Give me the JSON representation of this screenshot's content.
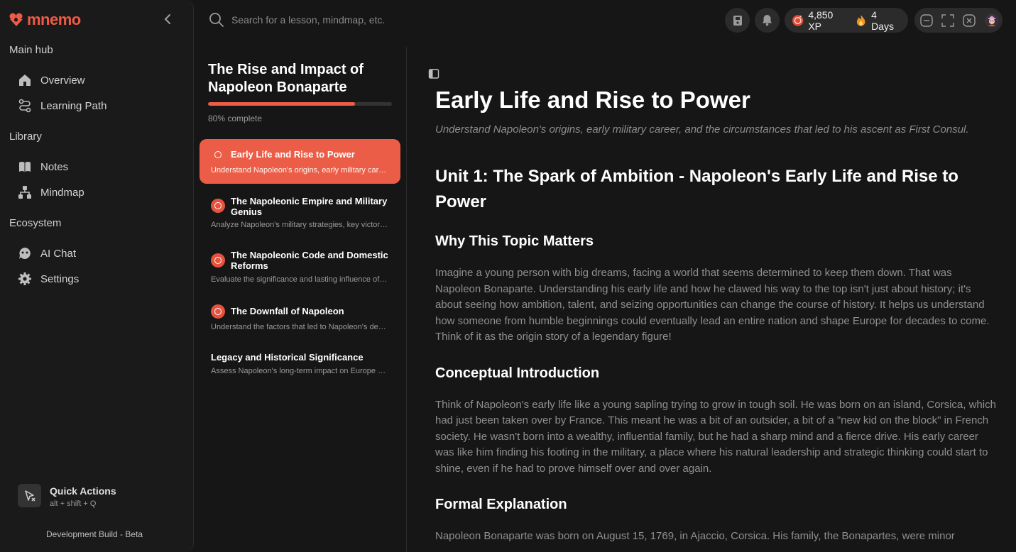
{
  "app": {
    "logo_text": "mnemo",
    "brand_color": "#ef5b45"
  },
  "sidebar": {
    "sections": [
      {
        "label": "Main hub",
        "items": [
          {
            "label": "Overview",
            "icon": "home-icon"
          },
          {
            "label": "Learning Path",
            "icon": "route-icon"
          }
        ]
      },
      {
        "label": "Library",
        "items": [
          {
            "label": "Notes",
            "icon": "book-icon"
          },
          {
            "label": "Mindmap",
            "icon": "hierarchy-icon"
          }
        ]
      },
      {
        "label": "Ecosystem",
        "items": [
          {
            "label": "AI Chat",
            "icon": "chat-bot-icon"
          },
          {
            "label": "Settings",
            "icon": "gear-icon"
          }
        ]
      }
    ],
    "quick_actions": {
      "title": "Quick Actions",
      "shortcut": "alt + shift + Q"
    },
    "build_label": "Development Build - Beta"
  },
  "topbar": {
    "search_placeholder": "Search for a lesson, mindmap, etc.",
    "xp": "4,850 XP",
    "streak": "4 Days"
  },
  "course": {
    "title": "The Rise and Impact of Napoleon Bonaparte",
    "progress": 0.8,
    "progress_text": "80% complete",
    "lessons": [
      {
        "title": "Early Life and Rise to Power",
        "desc": "Understand Napoleon's origins, early military career, and the circumstances that led to his ascent as First Consul."
      },
      {
        "title": "The Napoleonic Empire and Military Genius",
        "desc": "Analyze Napoleon's military strategies, key victories, and the expansion of his empire."
      },
      {
        "title": "The Napoleonic Code and Domestic Reforms",
        "desc": "Evaluate the significance and lasting influence of the Napoleonic Code."
      },
      {
        "title": "The Downfall of Napoleon",
        "desc": "Understand the factors that led to Napoleon's decline and exile."
      },
      {
        "title": "Legacy and Historical Significance",
        "desc": "Assess Napoleon's long-term impact on Europe and the world."
      }
    ]
  },
  "content": {
    "title": "Early Life and Rise to Power",
    "subtitle": "Understand Napoleon's origins, early military career, and the circumstances that led to his ascent as First Consul.",
    "unit_heading": "Unit 1: The Spark of Ambition - Napoleon's Early Life and Rise to Power",
    "sections": [
      {
        "heading": "Why This Topic Matters",
        "text": "Imagine a young person with big dreams, facing a world that seems determined to keep them down. That was Napoleon Bonaparte. Understanding his early life and how he clawed his way to the top isn't just about history; it's about seeing how ambition, talent, and seizing opportunities can change the course of history. It helps us understand how someone from humble beginnings could eventually lead an entire nation and shape Europe for decades to come. Think of it as the origin story of a legendary figure!"
      },
      {
        "heading": "Conceptual Introduction",
        "text": "Think of Napoleon's early life like a young sapling trying to grow in tough soil. He was born on an island, Corsica, which had just been taken over by France. This meant he was a bit of an outsider, a bit of a \"new kid on the block\" in French society. He wasn't born into a wealthy, influential family, but he had a sharp mind and a fierce drive. His early career was like him finding his footing in the military, a place where his natural leadership and strategic thinking could start to shine, even if he had to prove himself over and over again."
      },
      {
        "heading": "Formal Explanation",
        "text": "Napoleon Bonaparte was born on August 15, 1769, in Ajaccio, Corsica. His family, the Bonapartes, were minor"
      }
    ]
  }
}
